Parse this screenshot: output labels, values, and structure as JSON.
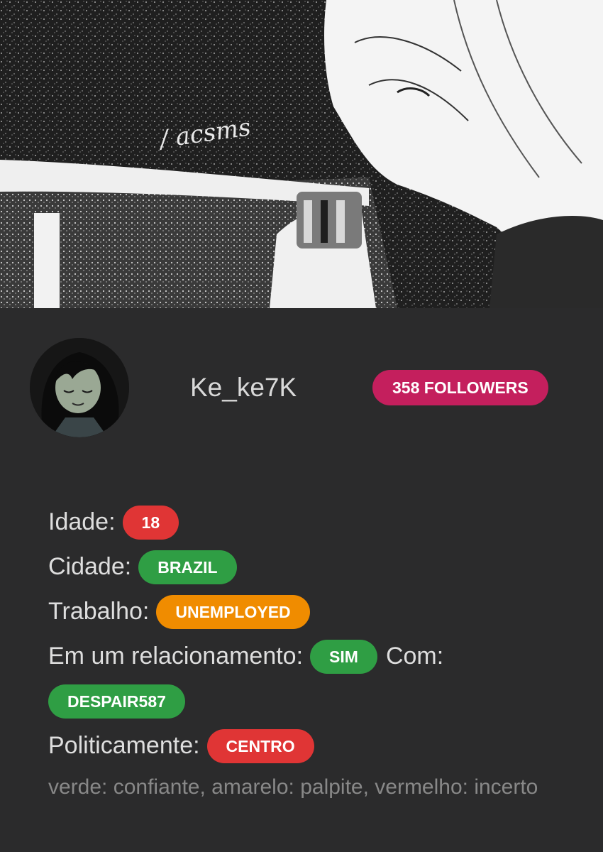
{
  "banner": {
    "watermark": "/ acsms"
  },
  "profile": {
    "username": "Ke_ke7K",
    "followers_label": "358 FOLLOWERS"
  },
  "info": {
    "age": {
      "label": "Idade:",
      "value": "18",
      "color": "#e03535"
    },
    "city": {
      "label": "Cidade:",
      "value": "BRAZIL",
      "color": "#2f9e44"
    },
    "work": {
      "label": "Trabalho:",
      "value": "UNEMPLOYED",
      "color": "#f08c00"
    },
    "relationship": {
      "label": "Em um relacionamento:",
      "value": "SIM",
      "with_label": "Com:",
      "partner": "DESPAIR587",
      "color": "#2f9e44"
    },
    "politics": {
      "label": "Politicamente:",
      "value": "CENTRO",
      "color": "#e03535"
    }
  },
  "legend": {
    "text": "verde: confiante, amarelo: palpite, vermelho: incerto"
  },
  "colors": {
    "background": "#2b2b2c",
    "followers_badge": "#c41f5d",
    "text": "#dedede",
    "legend_text": "#888888"
  }
}
